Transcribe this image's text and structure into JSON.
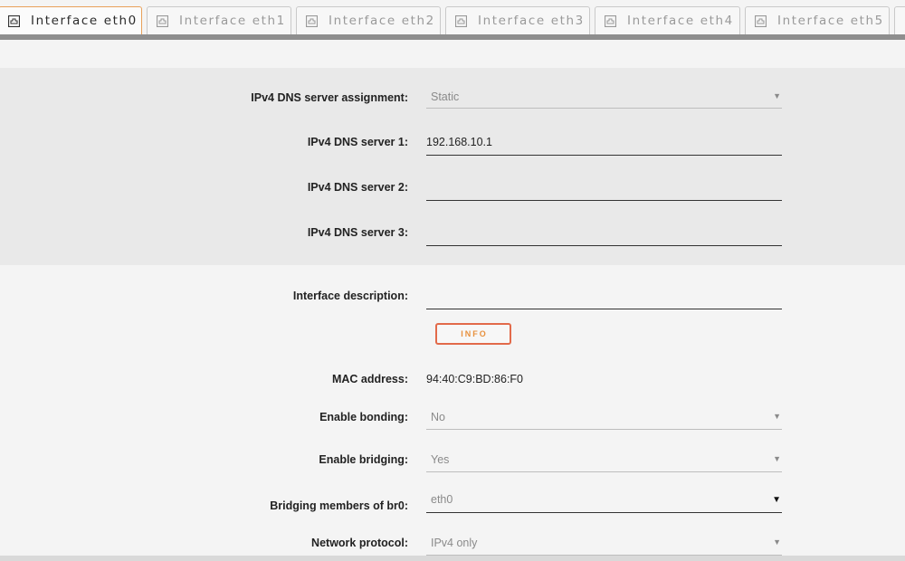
{
  "tabs": [
    {
      "label": "Interface eth0",
      "active": true
    },
    {
      "label": "Interface eth1",
      "active": false
    },
    {
      "label": "Interface eth2",
      "active": false
    },
    {
      "label": "Interface eth3",
      "active": false
    },
    {
      "label": "Interface eth4",
      "active": false
    },
    {
      "label": "Interface eth5",
      "active": false
    }
  ],
  "dns": {
    "assignment_label": "IPv4 DNS server assignment:",
    "assignment_value": "Static",
    "server1_label": "IPv4 DNS server 1:",
    "server1_value": "192.168.10.1",
    "server2_label": "IPv4 DNS server 2:",
    "server2_value": "",
    "server3_label": "IPv4 DNS server 3:",
    "server3_value": ""
  },
  "main": {
    "description_label": "Interface description:",
    "description_value": "",
    "info_button": "INFO",
    "mac_label": "MAC address:",
    "mac_value": "94:40:C9:BD:86:F0",
    "bonding_label": "Enable bonding:",
    "bonding_value": "No",
    "bridging_label": "Enable bridging:",
    "bridging_value": "Yes",
    "bridge_members_label": "Bridging members of br0:",
    "bridge_members_value": "eth0",
    "protocol_label": "Network protocol:",
    "protocol_value": "IPv4 only"
  },
  "icons": {
    "tab_icon": "ethernet-port-icon",
    "dropdown_icon": "caret-down-icon"
  },
  "colors": {
    "accent_orange": "#e8a15a",
    "info_border": "#e26a4a",
    "info_text": "#e8913e"
  }
}
